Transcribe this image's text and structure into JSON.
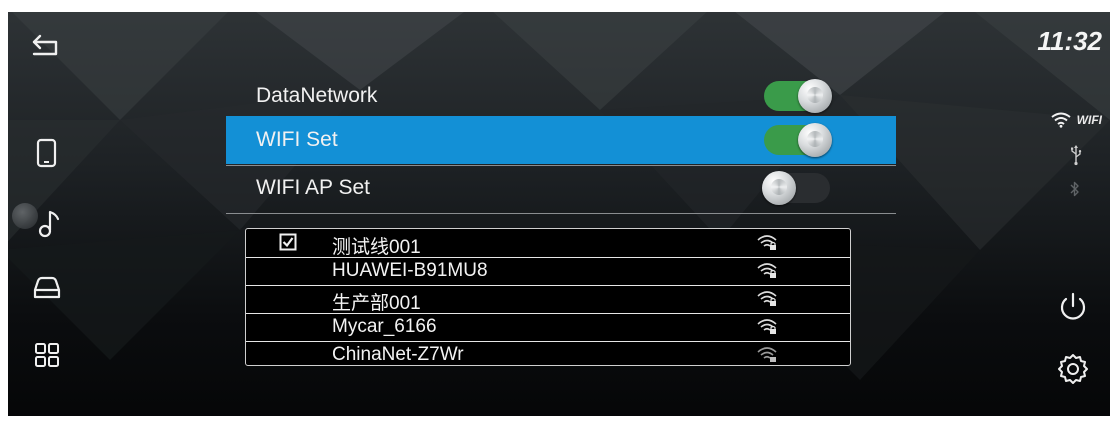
{
  "status_bar": {
    "clock": "11:32",
    "wifi_label": "WIFI",
    "icons": [
      "wifi-icon",
      "usb-icon",
      "bluetooth-icon"
    ]
  },
  "sidebar": {
    "items": [
      {
        "icon": "back-icon"
      },
      {
        "icon": "phone-icon"
      },
      {
        "icon": "music-note-icon"
      },
      {
        "icon": "car-icon"
      },
      {
        "icon": "apps-grid-icon"
      }
    ]
  },
  "settings": {
    "rows": [
      {
        "label": "DataNetwork",
        "toggle": "on",
        "selected": false
      },
      {
        "label": "WIFI Set",
        "toggle": "on",
        "selected": true
      },
      {
        "label": "WIFI AP Set",
        "toggle": "off",
        "selected": false
      }
    ]
  },
  "wifi_list": {
    "networks": [
      {
        "ssid": "测试线001",
        "connected": true,
        "secured": true
      },
      {
        "ssid": "HUAWEI-B91MU8",
        "connected": false,
        "secured": true
      },
      {
        "ssid": "生产部001",
        "connected": false,
        "secured": true
      },
      {
        "ssid": "Mycar_6166",
        "connected": false,
        "secured": true
      },
      {
        "ssid": "ChinaNet-Z7Wr",
        "connected": false,
        "secured": true
      }
    ]
  },
  "right_panel": {
    "icons": [
      "power-icon",
      "gear-icon"
    ]
  },
  "colors": {
    "selected_row": "#1390d6",
    "toggle_on": "#3a9b4a",
    "toggle_off": "#2a2d30"
  }
}
